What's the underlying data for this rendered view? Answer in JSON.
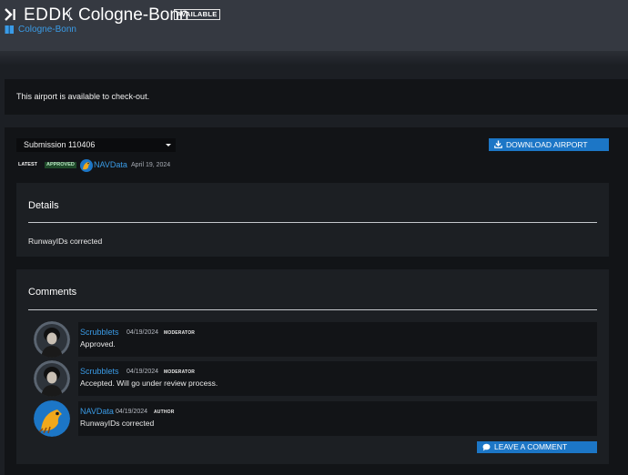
{
  "header": {
    "icao": "EDDK",
    "name": "Cologne-Bonn",
    "status_badge": "AVAILABLE",
    "breadcrumb": "Cologne-Bonn"
  },
  "notice": {
    "text": "This airport is available to check-out."
  },
  "submission": {
    "selected": "Submission 110406",
    "download_label": "DOWNLOAD AIRPORT",
    "tag_latest": "LATEST",
    "tag_approved": "APPROVED",
    "author": "NAVData",
    "date": "April 19, 2024"
  },
  "details": {
    "heading": "Details",
    "text": "RunwayIDs corrected"
  },
  "comments": {
    "heading": "Comments",
    "items": [
      {
        "author": "Scrubblets",
        "date": "04/19/2024",
        "role": "MODERATOR",
        "body": "Approved."
      },
      {
        "author": "Scrubblets",
        "date": "04/19/2024",
        "role": "MODERATOR",
        "body": "Accepted. Will go under review process."
      },
      {
        "author": "NAVData",
        "date": "04/19/2024",
        "role": "AUTHOR",
        "body": "RunwayIDs corrected"
      }
    ],
    "leave_label": "LEAVE A COMMENT"
  },
  "colors": {
    "accent": "#1c76c6",
    "link": "#3a9be6",
    "approved_bg": "#1f4a2a"
  },
  "icons": {
    "logo": "chevron-right-bar-icon",
    "breadcrumb": "book-icon",
    "download": "download-icon",
    "leave": "speech-bubble-icon"
  }
}
